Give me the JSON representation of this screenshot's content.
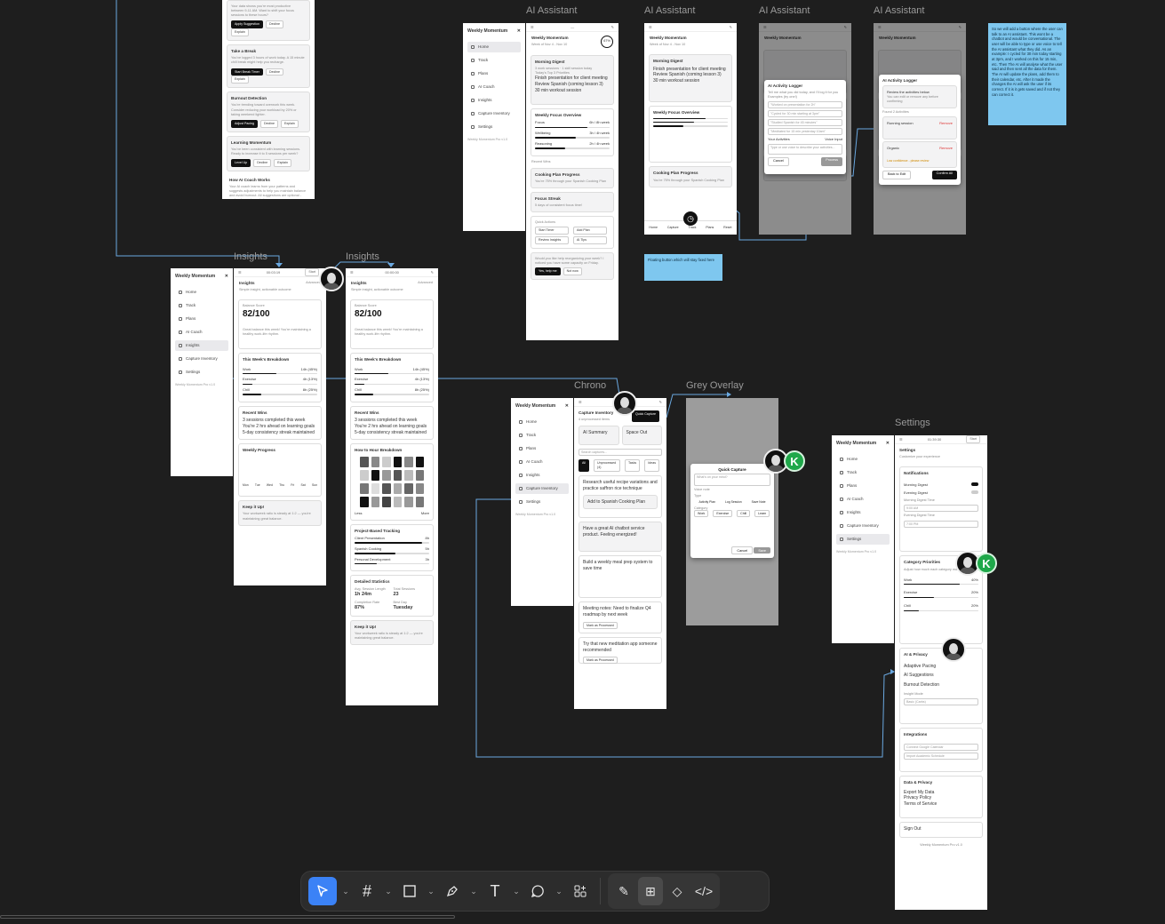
{
  "colors": {
    "canvas": "#1e1e1e",
    "wire": "#6aa8e0",
    "sticky": "#7ec7ef",
    "selected_tool": "#3b82f6",
    "avatar_k": "#1fa84a"
  },
  "labels": {
    "ai1": "AI Assistant",
    "ai2": "AI Assistant",
    "ai3": "AI Assistant",
    "ai4": "AI Assistant",
    "insights1": "Insights",
    "insights2": "Insights",
    "chrono": "Chrono",
    "grey_overlay": "Grey Overlay",
    "settings": "Settings"
  },
  "sticky_main": "So we will add a button where the user can talk to an AI assistant. This wont be a chatbot and would be conversational. The user will be able to type or use voice to tell the AI assistant what they did. As an example: I cycled for 30 min today starting at 3pm, and I worked on this for 15 min, etc. Then The AI will analyse what the user said and then sent all the data for them. The AI will update the plans, add them to their calendar, etc. After it made the changes the AI will ask the user if its correct. If it is it gets saved and if not they can correct it.",
  "sticky_small": "Floating button which will stay fixed here",
  "avatar_initial": "K",
  "top_fragment": {
    "lines": [
      "Your data shows you're most productive",
      "between 9-11 AM. Want to shift your focus",
      "sessions to these hours?"
    ],
    "btns": [
      "Apply Suggestion",
      "Decline",
      "Explain"
    ],
    "take_break": "Take a Break",
    "take_break_desc": "You've logged 3 hours of work today. A 15 minute chill break might help you recharge.",
    "break_btns": [
      "Start Break Timer",
      "Decline",
      "Explain"
    ],
    "burnout": "Burnout Detection",
    "burnout_desc": "You're trending toward overwork this week. Consider reducing your workload by 20% or taking weekend lighter.",
    "burnout_btns": [
      "Adjust Pacing",
      "Decline",
      "Explain"
    ],
    "learning": "Learning Momentum",
    "learning_desc": "You've been consistent with learning sessions. Ready to increase it to 5 sessions per week?",
    "learning_btns": [
      "Level Up",
      "Decline",
      "Explain"
    ],
    "how": "How AI Coach Works",
    "how_desc": "Your AI coach learns from your patterns and suggests adjustments to help you maintain balance and avoid burnout. All suggestions are optional - you're always in control."
  },
  "nav": {
    "brand": "Weekly Momentum",
    "items": [
      "Home",
      "Track",
      "Plans",
      "AI Coach",
      "Insights",
      "Capture Inventory",
      "Settings"
    ],
    "footer": "Weekly Momentum Pro v1.0"
  },
  "ai_screen": {
    "title": "Weekly Momentum",
    "dates": "Week of Nov 4 - Nov 10",
    "ring": "67%",
    "digest": "Morning Digest",
    "digest_sub": "3 work sessions · 1 skill session today",
    "priorities": "Today's Top 3 Priorities",
    "p_items": [
      "Finish presentation for client meeting",
      "Review Spanish (coming lesson 3)",
      "30 min workout session"
    ],
    "focus": "Weekly Focus Overview",
    "focus_rows": [
      [
        "Focus",
        "6h / 8h week"
      ],
      [
        "Wellbeing",
        "3h / 4h week"
      ],
      [
        "Reasoning",
        "2h / 4h week"
      ]
    ],
    "wins": "Recent Wins",
    "cooking": "Cooking Plan Progress",
    "cooking_desc": "You're 75% through your Spanish Cooking Plan",
    "streak": "Focus Streak",
    "streak_desc": "5 days of consistent focus time!",
    "quick": "Quick Actions",
    "qa": [
      "Start Timer",
      "Add Plan",
      "Review Insights",
      "AI Tips"
    ],
    "chat": "Would you like help reorganizing your week? I noticed you have some capacity on Friday.",
    "chat_btns": [
      "Yes, help me",
      "Not now"
    ],
    "tabs": [
      "Home",
      "Capture",
      "Track",
      "Plans",
      "Reset"
    ]
  },
  "logger": {
    "title": "AI Activity Logger",
    "subtitle": "Tell me what you did today, and I'll log it for you",
    "ex_label": "Examples (try one!)",
    "examples": [
      "\"Worked on presentation for 2h\"",
      "\"Cycled for 30 min starting at 3pm\"",
      "\"Studied Spanish for 45 minutes\"",
      "\"Meditated for 15 min yesterday 10am\""
    ],
    "your": "Your Activities",
    "voice": "Voice Input",
    "placeholder": "Type or use voice to describe your activities...",
    "cancel": "Cancel",
    "process": "Process"
  },
  "review": {
    "title": "AI Activity Logger",
    "note": "Review the activities below",
    "note2": "You can edit or remove any before confirming",
    "found": "Found 2 Activities",
    "a1": "Running session",
    "a2": "Organic",
    "remove": "Remove",
    "warn": "Low confidence - please review",
    "back": "Back to Edit",
    "confirm": "Confirm All"
  },
  "insights": {
    "title": "Insights",
    "subtitle": "Simple insight, actionable outcome",
    "toggle": "Advanced",
    "score_label": "Balance Score",
    "score": "82/100",
    "score_desc": "Great balance this week! You're maintaining a healthy work-life rhythm.",
    "breakdown": "This Week's Breakdown",
    "rows": [
      [
        "Work",
        "14h (45%)"
      ],
      [
        "Exercise",
        "4h (13%)"
      ],
      [
        "Chill",
        "8h (25%)"
      ]
    ],
    "wins": "Recent Wins",
    "win_items": [
      "3 sessions completed this week",
      "You're 2 hrs ahead on learning goals",
      "5-day consistency streak maintained"
    ],
    "progress": "Weekly Progress",
    "days": [
      "Mon",
      "Tue",
      "Wed",
      "Thu",
      "Fri",
      "Sat",
      "Sun"
    ],
    "keep": "Keep it Up!",
    "keep_desc": "Your workweek ratio is steady at 1:2 — you're maintaining great balance.",
    "heat_title": "How to Hour Breakdown",
    "legend_less": "Less",
    "legend_more": "More",
    "project": "Project-Based Tracking",
    "projects": [
      [
        "Client Presentation",
        "8h"
      ],
      [
        "Spanish Cooking",
        "5h"
      ],
      [
        "Personal Development",
        "3h"
      ]
    ],
    "stats": "Detailed Statistics",
    "stat_items": [
      [
        "Avg. Session Length",
        "1h 24m"
      ],
      [
        "Total Sessions",
        "23"
      ],
      [
        "Completion Rate",
        "87%"
      ],
      [
        "Best Day",
        "Tuesday"
      ]
    ],
    "timer1": "00:03:19",
    "timer1_btn": "Start",
    "timer2": "00:00:00"
  },
  "chrono": {
    "title": "Capture Inventory",
    "subtitle": "4 unprocessed items",
    "quick": "Quick Capture",
    "tab_ai": "AI Summary",
    "tab_space": "Space Out",
    "search": "Search captures...",
    "filters": [
      "All",
      "Unprocessed (4)",
      "Tasks",
      "Ideas",
      "Tasks"
    ],
    "items": [
      "Research useful recipe variations and practice saffron rice technique",
      "Have a great AI chatbot service product. Feeling energized!",
      "Build a weekly meal prep system to save time",
      "Meeting notes: Need to finalize Q4 roadmap by next week",
      "Try that new meditation app someone recommended"
    ],
    "add_plan": "Add to Spanish Cooking Plan",
    "mark": "Mark as Processed"
  },
  "quick_capture": {
    "title": "Quick Capture",
    "placeholder": "What's on your mind?",
    "voice": "Voice note",
    "section": "Type",
    "types": [
      "Activity Plan",
      "Log Session",
      "Save Note"
    ],
    "cat": "Category",
    "cats": [
      "Work",
      "Exercise",
      "Chill",
      "Learn"
    ],
    "cancel": "Cancel",
    "save": "Save"
  },
  "settings": {
    "title": "Settings",
    "subtitle": "Customize your experience",
    "timer": "01:39:30",
    "timer_btn": "Start",
    "notifications": "Notifications",
    "n_items": [
      "Morning Digest",
      "Evening Digest"
    ],
    "morning_time": "Morning Digest Time",
    "morning_val": "9:00 AM",
    "evening_time": "Evening Digest Time",
    "evening_val": "7:00 PM",
    "cat_priorities": "Category Priorities",
    "cat_desc": "Adjust how much each category matters to you",
    "cats": [
      [
        "Work",
        "40%"
      ],
      [
        "Exercise",
        "20%"
      ],
      [
        "Chill",
        "20%"
      ]
    ],
    "ai": "AI & Privacy",
    "ai_items": [
      "Adaptive Pacing",
      "AI Suggestions",
      "Burnout Detection"
    ],
    "insight_mode": "Insight Mode",
    "insight_val": "Basic (Carbs)",
    "integrations": "Integrations",
    "int_items": [
      "Connect Google Calendar",
      "Import Academic Schedule"
    ],
    "data": "Data & Privacy",
    "data_items": [
      "Export My Data",
      "Privacy Policy",
      "Terms of Service"
    ],
    "signout": "Sign Out",
    "footer": "Weekly Momentum Pro v1.0"
  },
  "toolbar": {
    "tools": [
      "move-tool",
      "frame-tool",
      "rectangle-tool",
      "pen-tool",
      "text-tool",
      "comment-tool",
      "actions-tool"
    ],
    "modes": [
      "draw-mode",
      "design-mode",
      "dev-resources",
      "code-mode"
    ]
  }
}
